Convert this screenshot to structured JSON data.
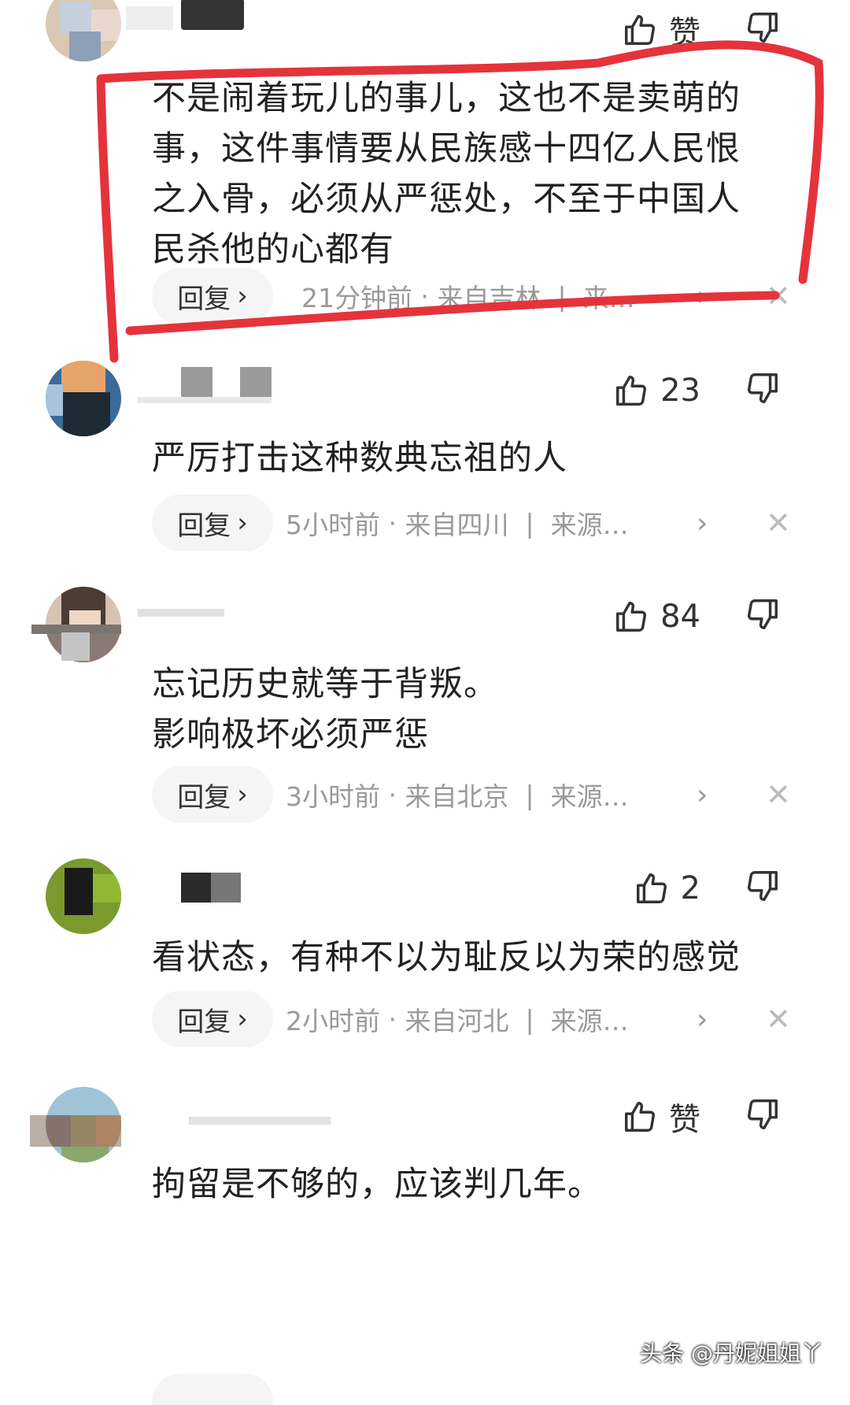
{
  "comments": [
    {
      "likes": "赞",
      "text": "不是闹着玩儿的事儿，这也不是卖萌的\n事，这件事情要从民族感十四亿人民恨\n之入骨，必须从严惩处，不至于中国人\n民杀他的心都有",
      "reply_label": "回复",
      "time": "21分钟前",
      "location": "来自吉林",
      "source": "来…"
    },
    {
      "likes": "23",
      "text": "严厉打击这种数典忘祖的人",
      "reply_label": "回复",
      "time": "5小时前",
      "location": "来自四川",
      "source": "来源…"
    },
    {
      "likes": "84",
      "text": "忘记历史就等于背叛。\n影响极坏必须严惩",
      "reply_label": "回复",
      "time": "3小时前",
      "location": "来自北京",
      "source": "来源…"
    },
    {
      "likes": "2",
      "text": "看状态，有种不以为耻反以为荣的感觉",
      "reply_label": "回复",
      "time": "2小时前",
      "location": "来自河北",
      "source": "来源…"
    },
    {
      "likes": "赞",
      "text": "拘留是不够的，应该判几年。"
    }
  ],
  "separator": "·",
  "divider": "|",
  "watermark": "头条 @丹妮姐姐丫",
  "colors": {
    "highlight": "#e5333b",
    "meta": "#9a9a9a"
  }
}
